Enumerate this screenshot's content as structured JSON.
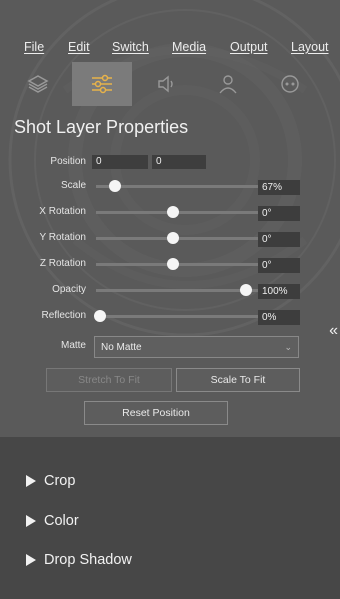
{
  "menu": [
    "File",
    "Edit",
    "Switch",
    "Media",
    "Output",
    "Layout"
  ],
  "toolbar": {
    "icons": [
      "layers-icon",
      "sliders-icon",
      "audio-icon",
      "person-icon",
      "mask-icon"
    ],
    "active_index": 1
  },
  "panel": {
    "title": "Shot Layer Properties",
    "position": {
      "label": "Position",
      "x": "0",
      "y": "0"
    },
    "sliders": [
      {
        "label": "Scale",
        "value": "67%",
        "level": 0.1
      },
      {
        "label": "X Rotation",
        "value": "0°",
        "level": 0.5
      },
      {
        "label": "Y Rotation",
        "value": "0°",
        "level": 0.5
      },
      {
        "label": "Z Rotation",
        "value": "0°",
        "level": 0.5
      },
      {
        "label": "Opacity",
        "value": "100%",
        "level": 1.0
      },
      {
        "label": "Reflection",
        "value": "0%",
        "level": 0.0
      }
    ],
    "matte": {
      "label": "Matte",
      "value": "No Matte"
    },
    "buttons": {
      "stretch": "Stretch To Fit",
      "scale": "Scale To Fit",
      "reset": "Reset Position"
    }
  },
  "sections": [
    "Crop",
    "Color",
    "Drop Shadow"
  ],
  "colors": {
    "panel_bg": "#5a5a5a",
    "lower_bg": "#474747",
    "active_tab": "#7b7b7b"
  }
}
